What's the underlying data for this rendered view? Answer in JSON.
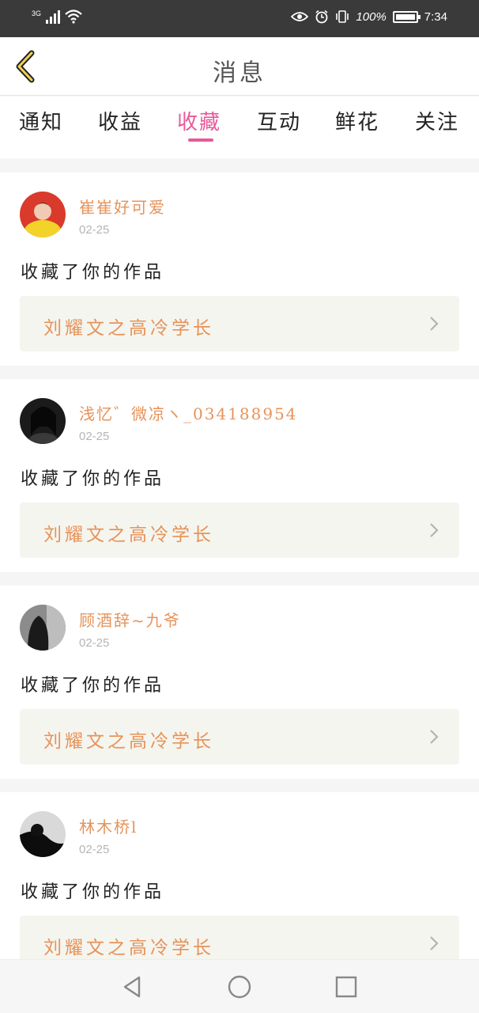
{
  "status_bar": {
    "network": "3G",
    "battery_text": "100%",
    "time": "7:34",
    "icons": [
      "signal-icon",
      "wifi-icon",
      "eye-icon",
      "alarm-icon",
      "vibrate-icon",
      "battery-icon"
    ]
  },
  "header": {
    "title": "消息",
    "back_icon": "chevron-left-icon"
  },
  "tabs": [
    {
      "label": "通知",
      "active": false
    },
    {
      "label": "收益",
      "active": false
    },
    {
      "label": "收藏",
      "active": true
    },
    {
      "label": "互动",
      "active": false
    },
    {
      "label": "鲜花",
      "active": false
    },
    {
      "label": "关注",
      "active": false
    }
  ],
  "colors": {
    "accent": "#e8599a",
    "username": "#e6935a",
    "work_box_bg": "#f5f5ef"
  },
  "messages": [
    {
      "username": "崔崔好可爱",
      "date": "02-25",
      "action": "收藏了你的作品",
      "work_title": "刘耀文之高冷学长"
    },
    {
      "username": "浅忆゛微凉ヽ_034188954",
      "date": "02-25",
      "action": "收藏了你的作品",
      "work_title": "刘耀文之高冷学长"
    },
    {
      "username": "顾酒辞~九爷",
      "date": "02-25",
      "action": "收藏了你的作品",
      "work_title": "刘耀文之高冷学长"
    },
    {
      "username": "林木桥l",
      "date": "02-25",
      "action": "收藏了你的作品",
      "work_title": "刘耀文之高冷学长"
    }
  ],
  "nav": {
    "icons": [
      "back-triangle-icon",
      "home-circle-icon",
      "recents-square-icon"
    ]
  }
}
